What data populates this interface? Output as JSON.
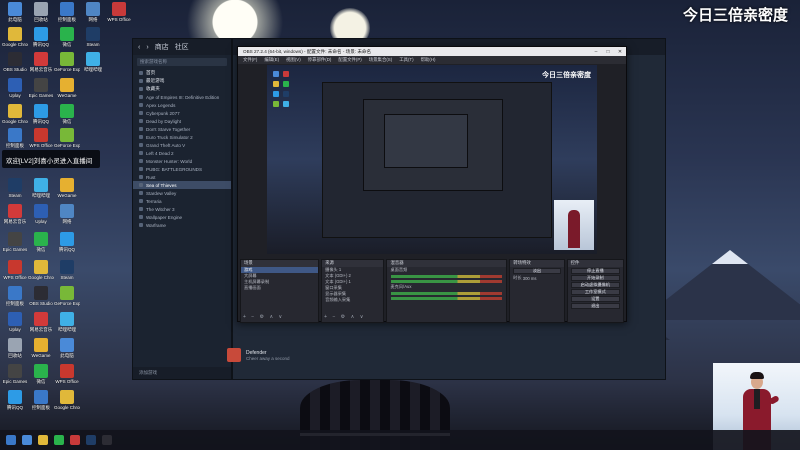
{
  "overlay_title": "今日三倍亲密度",
  "banner_text": "欢迎[LV2]刘喜小灵进入直播间",
  "desktop_icons": [
    {
      "label": "此电脑",
      "color": "#4a8ad8"
    },
    {
      "label": "回收站",
      "color": "#9aa4b2"
    },
    {
      "label": "控制面板",
      "color": "#3a78c8"
    },
    {
      "label": "网络",
      "color": "#4f86c4"
    },
    {
      "label": "Google Chrome",
      "color": "#e0b83a"
    },
    {
      "label": "腾讯QQ",
      "color": "#2d9be6"
    },
    {
      "label": "微信",
      "color": "#2ab34c"
    },
    {
      "label": "Steam",
      "color": "#1f3d66"
    },
    {
      "label": "OBS Studio",
      "color": "#2c2c34"
    },
    {
      "label": "网易云音乐",
      "color": "#d23a3a"
    },
    {
      "label": "WPS Office",
      "color": "#c8382e"
    },
    {
      "label": "哔哩哔哩",
      "color": "#3fb0e6"
    },
    {
      "label": "GeForce Experience",
      "color": "#78b838"
    },
    {
      "label": "Uplay",
      "color": "#2d5fb4"
    },
    {
      "label": "Epic Games",
      "color": "#333"
    },
    {
      "label": "WeGame",
      "color": "#e6b030"
    }
  ],
  "steam": {
    "tabs": [
      "商店",
      "社区",
      "查内明曦"
    ],
    "search_placeholder": "搜索游戏名称",
    "sections": [
      "首页",
      "最近游戏",
      "收藏夹"
    ],
    "games": [
      "Age of Empires III: Definitive Edition",
      "Apex Legends",
      "Cyberpunk 2077",
      "Dead by Daylight",
      "Don't Starve Together",
      "Euro Truck Simulator 2",
      "Grand Theft Auto V",
      "Left 4 Dead 2",
      "Monster Hunter: World",
      "PUBG: BATTLEGROUNDS",
      "Rust",
      "Sea of Thieves",
      "Stardew Valley",
      "Terraria",
      "The Witcher 3",
      "Wallpaper Engine",
      "Warframe"
    ],
    "selected_game": "Sea of Thieves",
    "bottom_label": "添加游戏",
    "friend_name": "Defender",
    "friend_status": "Cheer away a second"
  },
  "obs": {
    "title": "OBS 27.2.4 (64-bit, windows) - 配置文件: 未命名 - 场景: 未命名",
    "menu": [
      "文件(F)",
      "编辑(E)",
      "视图(V)",
      "停靠部件(D)",
      "配置文件(P)",
      "场景集合(S)",
      "工具(T)",
      "帮助(H)"
    ],
    "docks": {
      "scenes_header": "场景",
      "scenes": [
        "游戏",
        "大屏幕",
        "主机屏幕录制",
        "直播画面"
      ],
      "selected_scene": "游戏",
      "sources_header": "来源",
      "sources": [
        "摄像头 1",
        "文本 (GDI+) 2",
        "文本 (GDI+) 1",
        "窗口采集",
        "显示器采集",
        "音频输入采集"
      ],
      "mixer_header": "混音器",
      "mixer": [
        "桌面音频",
        "麦克风/Aux"
      ],
      "transitions_header": "转场特效",
      "transition_type": "淡出",
      "duration_label": "时长",
      "duration_value": "300 ms",
      "controls_header": "控件",
      "controls": [
        "停止直播",
        "开始录制",
        "启动虚拟摄像机",
        "工作室模式",
        "设置",
        "退出"
      ]
    }
  }
}
